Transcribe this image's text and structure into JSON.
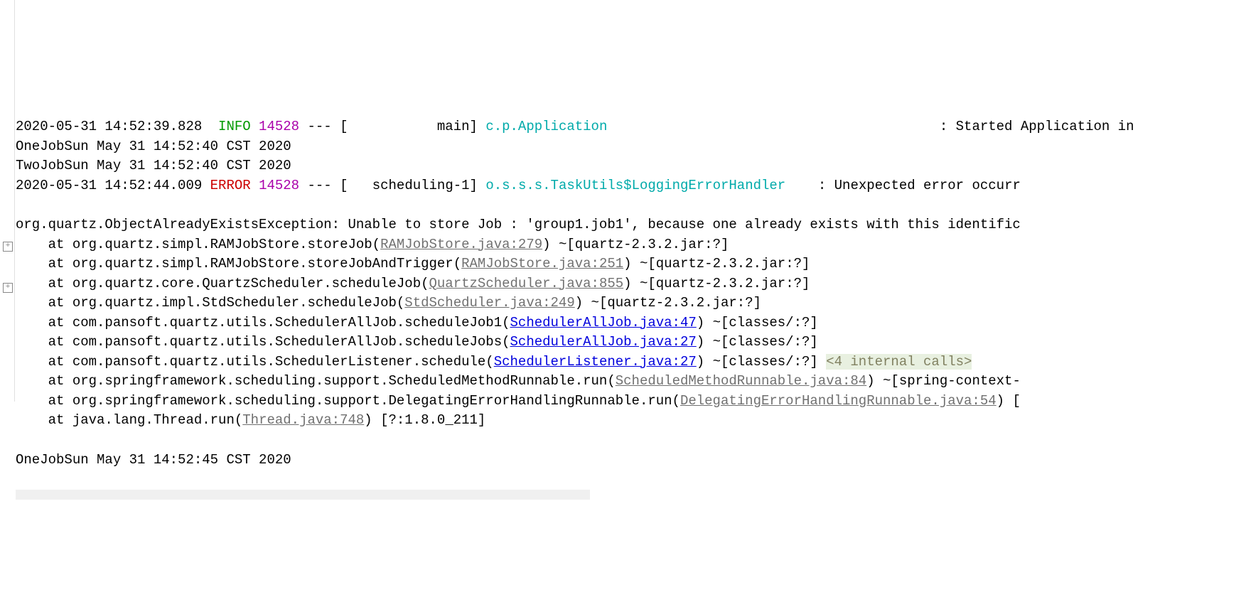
{
  "lines": {
    "l0_ts": "2020-05-31 14:52:39.828  ",
    "l0_level": "INFO",
    "l0_pid": " 14528",
    "l0_mid": " --- [           main] ",
    "l0_logger": "c.p.Application",
    "l0_sep": "                                         : ",
    "l0_msg": "Started Application in",
    "l1": "OneJobSun May 31 14:52:40 CST 2020",
    "l2": "TwoJobSun May 31 14:52:40 CST 2020",
    "l3_ts": "2020-05-31 14:52:44.009 ",
    "l3_level": "ERROR",
    "l3_pid": " 14528",
    "l3_mid": " --- [   scheduling-1] ",
    "l3_logger": "o.s.s.s.TaskUtils$LoggingErrorHandler",
    "l3_sep": "    : ",
    "l3_msg": "Unexpected error occurr",
    "l4": "",
    "l5": "org.quartz.ObjectAlreadyExistsException: Unable to store Job : 'group1.job1', because one already exists with this identific",
    "st1_pre": "    at org.quartz.simpl.RAMJobStore.storeJob(",
    "st1_link": "RAMJobStore.java:279",
    "st1_post": ") ~[quartz-2.3.2.jar:?]",
    "st2_pre": "    at org.quartz.simpl.RAMJobStore.storeJobAndTrigger(",
    "st2_link": "RAMJobStore.java:251",
    "st2_post": ") ~[quartz-2.3.2.jar:?]",
    "st3_pre": "    at org.quartz.core.QuartzScheduler.scheduleJob(",
    "st3_link": "QuartzScheduler.java:855",
    "st3_post": ") ~[quartz-2.3.2.jar:?]",
    "st4_pre": "    at org.quartz.impl.StdScheduler.scheduleJob(",
    "st4_link": "StdScheduler.java:249",
    "st4_post": ") ~[quartz-2.3.2.jar:?]",
    "st5_pre": "    at com.pansoft.quartz.utils.SchedulerAllJob.scheduleJob1(",
    "st5_link": "SchedulerAllJob.java:47",
    "st5_post": ") ~[classes/:?]",
    "st6_pre": "    at com.pansoft.quartz.utils.SchedulerAllJob.scheduleJobs(",
    "st6_link": "SchedulerAllJob.java:27",
    "st6_post": ") ~[classes/:?]",
    "st7_pre": "    at com.pansoft.quartz.utils.SchedulerListener.schedule(",
    "st7_link": "SchedulerListener.java:27",
    "st7_post": ") ~[classes/:?] ",
    "st7_internal": "<4 internal calls>",
    "st8_pre": "    at org.springframework.scheduling.support.ScheduledMethodRunnable.run(",
    "st8_link": "ScheduledMethodRunnable.java:84",
    "st8_post": ") ~[spring-context-",
    "st9_pre": "    at org.springframework.scheduling.support.DelegatingErrorHandlingRunnable.run(",
    "st9_link": "DelegatingErrorHandlingRunnable.java:54",
    "st9_post": ") [",
    "st10_pre": "    at java.lang.Thread.run(",
    "st10_link": "Thread.java:748",
    "st10_post": ") [?:1.8.0_211]",
    "l_blank2": "",
    "l_last": "OneJobSun May 31 14:52:45 CST 2020"
  },
  "fold": {
    "plus": "+"
  }
}
